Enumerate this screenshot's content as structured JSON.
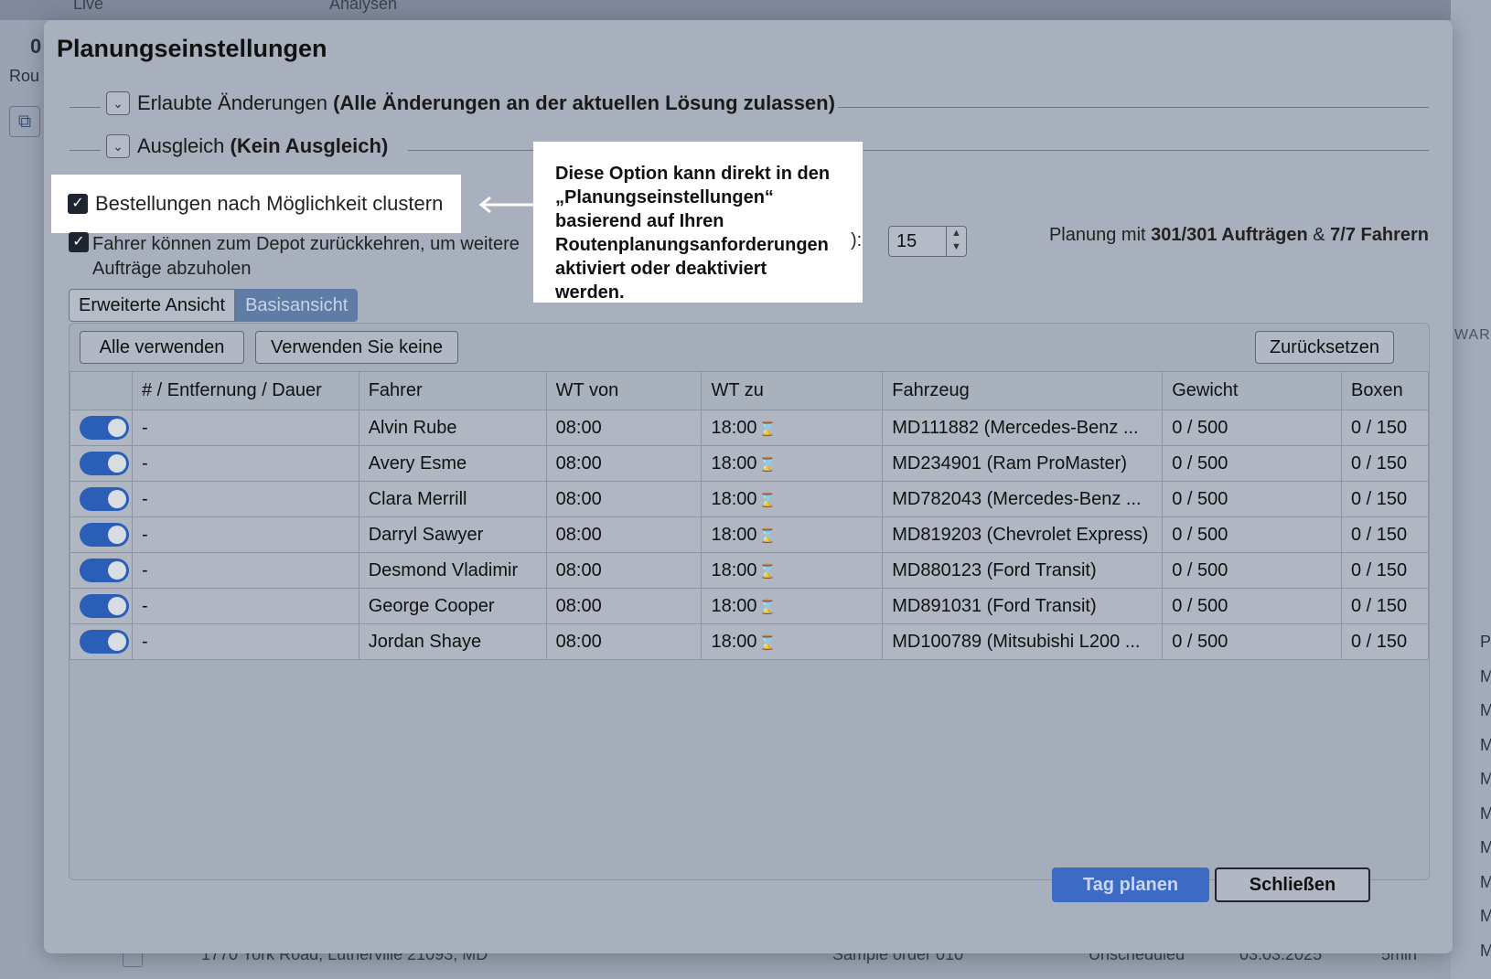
{
  "background": {
    "topbar_left": "Live",
    "topbar_right": "Analysen",
    "left_number": "0",
    "left_label": "Rou",
    "map_label": "WAR",
    "right_column_letter": "P",
    "right_column_items": [
      "M",
      "M",
      "M",
      "M",
      "M",
      "M",
      "M",
      "M",
      "M"
    ],
    "bottom_row": {
      "address": "1770 York Road, Lutherville 21093, MD",
      "order": "Sample order 010",
      "status": "Unscheduled",
      "date": "03.03.2025",
      "duration": "5min"
    }
  },
  "modal": {
    "title": "Planungseinstellungen",
    "sections": {
      "allowed_changes": {
        "label": "Erlaubte Änderungen",
        "value": "(Alle Änderungen an der aktuellen Lösung zulassen)"
      },
      "balance": {
        "label": "Ausgleich",
        "value": "(Kein Ausgleich)"
      }
    },
    "cluster_option": {
      "label": "Bestellungen nach Möglichkeit clustern",
      "checked": true
    },
    "tooltip": "Diese Option kann direkt in den „Planungseinstellungen“ basierend auf Ihren Routenplanungsanforderungen aktiviert oder deaktiviert werden.",
    "depot_option": {
      "label": "Fahrer können zum Depot zurückkehren, um weitere Aufträge abzuholen",
      "checked": true
    },
    "obscured_label_tail": "):",
    "number_input_value": "15",
    "summary": {
      "prefix": "Planung mit",
      "orders": "301/301 Aufträgen",
      "ampersand": "&",
      "drivers": "7/7 Fahrern"
    },
    "view_tabs": {
      "advanced": "Erweiterte Ansicht",
      "basic": "Basisansicht"
    },
    "buttons": {
      "use_all": "Alle verwenden",
      "use_none": "Verwenden Sie keine",
      "reset": "Zurücksetzen",
      "plan_day": "Tag planen",
      "close": "Schließen"
    },
    "table": {
      "headers": [
        "",
        "# / Entfernung / Dauer",
        "Fahrer",
        "WT von",
        "WT zu",
        "Fahrzeug",
        "Gewicht",
        "Boxen"
      ],
      "rows": [
        {
          "enabled": true,
          "distance": "-",
          "driver": "Alvin Rube",
          "from": "08:00",
          "to": "18:00",
          "vehicle": "MD111882 (Mercedes-Benz ...",
          "weight": "0 / 500",
          "boxes": "0 / 150"
        },
        {
          "enabled": true,
          "distance": "-",
          "driver": "Avery Esme",
          "from": "08:00",
          "to": "18:00",
          "vehicle": "MD234901 (Ram ProMaster)",
          "weight": "0 / 500",
          "boxes": "0 / 150"
        },
        {
          "enabled": true,
          "distance": "-",
          "driver": "Clara Merrill",
          "from": "08:00",
          "to": "18:00",
          "vehicle": "MD782043 (Mercedes-Benz ...",
          "weight": "0 / 500",
          "boxes": "0 / 150"
        },
        {
          "enabled": true,
          "distance": "-",
          "driver": "Darryl Sawyer",
          "from": "08:00",
          "to": "18:00",
          "vehicle": "MD819203 (Chevrolet Express)",
          "weight": "0 / 500",
          "boxes": "0 / 150"
        },
        {
          "enabled": true,
          "distance": "-",
          "driver": "Desmond Vladimir",
          "from": "08:00",
          "to": "18:00",
          "vehicle": "MD880123 (Ford Transit)",
          "weight": "0 / 500",
          "boxes": "0 / 150"
        },
        {
          "enabled": true,
          "distance": "-",
          "driver": "George Cooper",
          "from": "08:00",
          "to": "18:00",
          "vehicle": "MD891031 (Ford Transit)",
          "weight": "0 / 500",
          "boxes": "0 / 150"
        },
        {
          "enabled": true,
          "distance": "-",
          "driver": "Jordan Shaye",
          "from": "08:00",
          "to": "18:00",
          "vehicle": "MD100789 (Mitsubishi L200 ...",
          "weight": "0 / 500",
          "boxes": "0 / 150"
        }
      ]
    }
  },
  "colors": {
    "primary_button": "#3d6bc4",
    "toggle_on": "#2b5fb7",
    "inactive_tab": "#5f7ca6"
  },
  "icons": {
    "section_toggle": "chevron-down-icon",
    "time_window": "hourglass-icon",
    "arrow": "arrow-left-icon",
    "checkbox": "check-icon"
  }
}
